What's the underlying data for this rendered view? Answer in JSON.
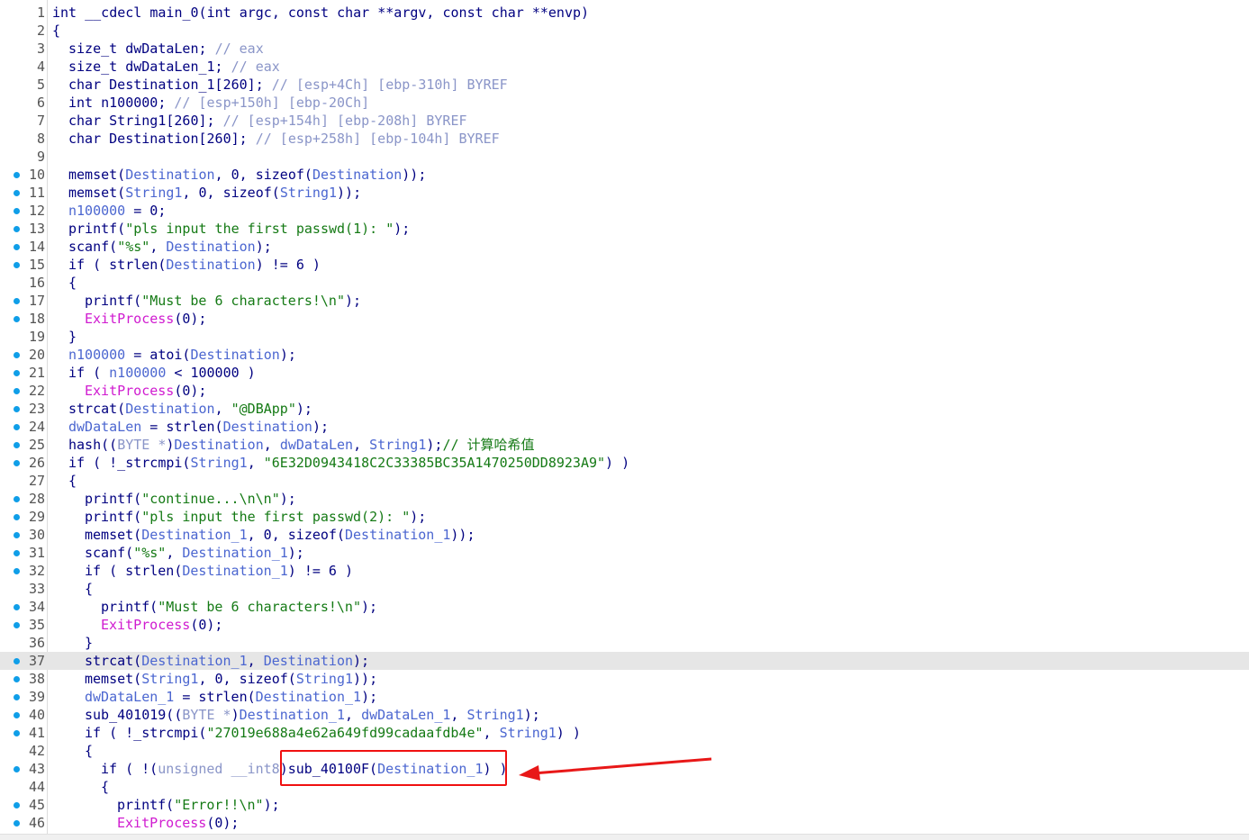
{
  "editor": {
    "lines": [
      {
        "n": "1",
        "bp": false,
        "indent": 0,
        "tokens": [
          [
            "int __cdecl main_0(int argc, const char **argv, const char **envp)",
            ""
          ]
        ]
      },
      {
        "n": "2",
        "bp": false,
        "indent": 0,
        "tokens": [
          [
            "{",
            ""
          ]
        ]
      },
      {
        "n": "3",
        "bp": false,
        "indent": 1,
        "tokens": [
          [
            "size_t dwDataLen; ",
            ""
          ],
          [
            "// eax",
            "c"
          ]
        ]
      },
      {
        "n": "4",
        "bp": false,
        "indent": 1,
        "tokens": [
          [
            "size_t dwDataLen_1; ",
            ""
          ],
          [
            "// eax",
            "c"
          ]
        ]
      },
      {
        "n": "5",
        "bp": false,
        "indent": 1,
        "tokens": [
          [
            "char Destination_1[260]; ",
            ""
          ],
          [
            "// [esp+4Ch] [ebp-310h] BYREF",
            "c"
          ]
        ]
      },
      {
        "n": "6",
        "bp": false,
        "indent": 1,
        "tokens": [
          [
            "int n100000; ",
            ""
          ],
          [
            "// [esp+150h] [ebp-20Ch]",
            "c"
          ]
        ]
      },
      {
        "n": "7",
        "bp": false,
        "indent": 1,
        "tokens": [
          [
            "char String1[260]; ",
            ""
          ],
          [
            "// [esp+154h] [ebp-208h] BYREF",
            "c"
          ]
        ]
      },
      {
        "n": "8",
        "bp": false,
        "indent": 1,
        "tokens": [
          [
            "char Destination[260]; ",
            ""
          ],
          [
            "// [esp+258h] [ebp-104h] BYREF",
            "c"
          ]
        ]
      },
      {
        "n": "9",
        "bp": false,
        "indent": 0,
        "tokens": []
      },
      {
        "n": "10",
        "bp": true,
        "indent": 1,
        "tokens": [
          [
            "memset(",
            ""
          ],
          [
            "Destination",
            "v"
          ],
          [
            ", 0, sizeof(",
            ""
          ],
          [
            "Destination",
            "v"
          ],
          [
            "));",
            ""
          ]
        ]
      },
      {
        "n": "11",
        "bp": true,
        "indent": 1,
        "tokens": [
          [
            "memset(",
            ""
          ],
          [
            "String1",
            "v"
          ],
          [
            ", 0, sizeof(",
            ""
          ],
          [
            "String1",
            "v"
          ],
          [
            "));",
            ""
          ]
        ]
      },
      {
        "n": "12",
        "bp": true,
        "indent": 1,
        "tokens": [
          [
            "n100000",
            "v"
          ],
          [
            " = 0;",
            ""
          ]
        ]
      },
      {
        "n": "13",
        "bp": true,
        "indent": 1,
        "tokens": [
          [
            "printf(",
            ""
          ],
          [
            "\"pls input the first passwd(1): \"",
            "s"
          ],
          [
            ");",
            ""
          ]
        ]
      },
      {
        "n": "14",
        "bp": true,
        "indent": 1,
        "tokens": [
          [
            "scanf(",
            ""
          ],
          [
            "\"%s\"",
            "s"
          ],
          [
            ", ",
            ""
          ],
          [
            "Destination",
            "v"
          ],
          [
            ");",
            ""
          ]
        ]
      },
      {
        "n": "15",
        "bp": true,
        "indent": 1,
        "tokens": [
          [
            "if ( strlen(",
            ""
          ],
          [
            "Destination",
            "v"
          ],
          [
            ") != 6 )",
            ""
          ]
        ]
      },
      {
        "n": "16",
        "bp": false,
        "indent": 1,
        "tokens": [
          [
            "{",
            ""
          ]
        ]
      },
      {
        "n": "17",
        "bp": true,
        "indent": 2,
        "tokens": [
          [
            "printf(",
            ""
          ],
          [
            "\"Must be 6 characters!\\n\"",
            "s"
          ],
          [
            ");",
            ""
          ]
        ]
      },
      {
        "n": "18",
        "bp": true,
        "indent": 2,
        "tokens": [
          [
            "ExitProcess",
            "m"
          ],
          [
            "(0);",
            ""
          ]
        ]
      },
      {
        "n": "19",
        "bp": false,
        "indent": 1,
        "tokens": [
          [
            "}",
            ""
          ]
        ]
      },
      {
        "n": "20",
        "bp": true,
        "indent": 1,
        "tokens": [
          [
            "n100000",
            "v"
          ],
          [
            " = atoi(",
            ""
          ],
          [
            "Destination",
            "v"
          ],
          [
            ");",
            ""
          ]
        ]
      },
      {
        "n": "21",
        "bp": true,
        "indent": 1,
        "tokens": [
          [
            "if ( ",
            ""
          ],
          [
            "n100000",
            "v"
          ],
          [
            " < 100000 )",
            ""
          ]
        ]
      },
      {
        "n": "22",
        "bp": true,
        "indent": 2,
        "tokens": [
          [
            "ExitProcess",
            "m"
          ],
          [
            "(0);",
            ""
          ]
        ]
      },
      {
        "n": "23",
        "bp": true,
        "indent": 1,
        "tokens": [
          [
            "strcat(",
            ""
          ],
          [
            "Destination",
            "v"
          ],
          [
            ", ",
            ""
          ],
          [
            "\"@DBApp\"",
            "s"
          ],
          [
            ");",
            ""
          ]
        ]
      },
      {
        "n": "24",
        "bp": true,
        "indent": 1,
        "tokens": [
          [
            "dwDataLen",
            "v"
          ],
          [
            " = strlen(",
            ""
          ],
          [
            "Destination",
            "v"
          ],
          [
            ");",
            ""
          ]
        ]
      },
      {
        "n": "25",
        "bp": true,
        "indent": 1,
        "tokens": [
          [
            "hash((",
            ""
          ],
          [
            "BYTE *",
            "c"
          ],
          [
            ")",
            ""
          ],
          [
            "Destination",
            "v"
          ],
          [
            ", ",
            ""
          ],
          [
            "dwDataLen",
            "v"
          ],
          [
            ", ",
            ""
          ],
          [
            "String1",
            "v"
          ],
          [
            ");",
            ""
          ],
          [
            "// 计算哈希值",
            "s"
          ]
        ]
      },
      {
        "n": "26",
        "bp": true,
        "indent": 1,
        "tokens": [
          [
            "if ( !_strcmpi(",
            ""
          ],
          [
            "String1",
            "v"
          ],
          [
            ", ",
            ""
          ],
          [
            "\"6E32D0943418C2C33385BC35A1470250DD8923A9\"",
            "s"
          ],
          [
            ") )",
            ""
          ]
        ]
      },
      {
        "n": "27",
        "bp": false,
        "indent": 1,
        "tokens": [
          [
            "{",
            ""
          ]
        ]
      },
      {
        "n": "28",
        "bp": true,
        "indent": 2,
        "tokens": [
          [
            "printf(",
            ""
          ],
          [
            "\"continue...\\n\\n\"",
            "s"
          ],
          [
            ");",
            ""
          ]
        ]
      },
      {
        "n": "29",
        "bp": true,
        "indent": 2,
        "tokens": [
          [
            "printf(",
            ""
          ],
          [
            "\"pls input the first passwd(2): \"",
            "s"
          ],
          [
            ");",
            ""
          ]
        ]
      },
      {
        "n": "30",
        "bp": true,
        "indent": 2,
        "tokens": [
          [
            "memset(",
            ""
          ],
          [
            "Destination_1",
            "v"
          ],
          [
            ", 0, sizeof(",
            ""
          ],
          [
            "Destination_1",
            "v"
          ],
          [
            "));",
            ""
          ]
        ]
      },
      {
        "n": "31",
        "bp": true,
        "indent": 2,
        "tokens": [
          [
            "scanf(",
            ""
          ],
          [
            "\"%s\"",
            "s"
          ],
          [
            ", ",
            ""
          ],
          [
            "Destination_1",
            "v"
          ],
          [
            ");",
            ""
          ]
        ]
      },
      {
        "n": "32",
        "bp": true,
        "indent": 2,
        "tokens": [
          [
            "if ( strlen(",
            ""
          ],
          [
            "Destination_1",
            "v"
          ],
          [
            ") != 6 )",
            ""
          ]
        ]
      },
      {
        "n": "33",
        "bp": false,
        "indent": 2,
        "tokens": [
          [
            "{",
            ""
          ]
        ]
      },
      {
        "n": "34",
        "bp": true,
        "indent": 3,
        "tokens": [
          [
            "printf(",
            ""
          ],
          [
            "\"Must be 6 characters!\\n\"",
            "s"
          ],
          [
            ");",
            ""
          ]
        ]
      },
      {
        "n": "35",
        "bp": true,
        "indent": 3,
        "tokens": [
          [
            "ExitProcess",
            "m"
          ],
          [
            "(0);",
            ""
          ]
        ]
      },
      {
        "n": "36",
        "bp": false,
        "indent": 2,
        "tokens": [
          [
            "}",
            ""
          ]
        ]
      },
      {
        "n": "37",
        "bp": true,
        "indent": 2,
        "hl": true,
        "tokens": [
          [
            "strcat(",
            ""
          ],
          [
            "Destination_1",
            "v"
          ],
          [
            ", ",
            ""
          ],
          [
            "Destination",
            "v"
          ],
          [
            ");",
            ""
          ]
        ]
      },
      {
        "n": "38",
        "bp": true,
        "indent": 2,
        "tokens": [
          [
            "memset(",
            ""
          ],
          [
            "String1",
            "v"
          ],
          [
            ", 0, sizeof(",
            ""
          ],
          [
            "String1",
            "v"
          ],
          [
            "));",
            ""
          ]
        ]
      },
      {
        "n": "39",
        "bp": true,
        "indent": 2,
        "tokens": [
          [
            "dwDataLen_1",
            "v"
          ],
          [
            " = strlen(",
            ""
          ],
          [
            "Destination_1",
            "v"
          ],
          [
            ");",
            ""
          ]
        ]
      },
      {
        "n": "40",
        "bp": true,
        "indent": 2,
        "tokens": [
          [
            "sub_401019((",
            ""
          ],
          [
            "BYTE *",
            "c"
          ],
          [
            ")",
            ""
          ],
          [
            "Destination_1",
            "v"
          ],
          [
            ", ",
            ""
          ],
          [
            "dwDataLen_1",
            "v"
          ],
          [
            ", ",
            ""
          ],
          [
            "String1",
            "v"
          ],
          [
            ");",
            ""
          ]
        ]
      },
      {
        "n": "41",
        "bp": true,
        "indent": 2,
        "tokens": [
          [
            "if ( !_strcmpi(",
            ""
          ],
          [
            "\"27019e688a4e62a649fd99cadaafdb4e\"",
            "s"
          ],
          [
            ", ",
            ""
          ],
          [
            "String1",
            "v"
          ],
          [
            ") )",
            ""
          ]
        ]
      },
      {
        "n": "42",
        "bp": false,
        "indent": 2,
        "tokens": [
          [
            "{",
            ""
          ]
        ]
      },
      {
        "n": "43",
        "bp": true,
        "indent": 3,
        "tokens": [
          [
            "if ( !(",
            ""
          ],
          [
            "unsigned __int8",
            "c"
          ],
          [
            ")sub_40100F(",
            ""
          ],
          [
            "Destination_1",
            "v"
          ],
          [
            ") )",
            ""
          ]
        ]
      },
      {
        "n": "44",
        "bp": false,
        "indent": 3,
        "tokens": [
          [
            "{",
            ""
          ]
        ]
      },
      {
        "n": "45",
        "bp": true,
        "indent": 4,
        "tokens": [
          [
            "printf(",
            ""
          ],
          [
            "\"Error!!\\n\"",
            "s"
          ],
          [
            ");",
            ""
          ]
        ]
      },
      {
        "n": "46",
        "bp": true,
        "indent": 4,
        "tokens": [
          [
            "ExitProcess",
            "m"
          ],
          [
            "(0);",
            ""
          ]
        ]
      }
    ]
  },
  "annotation": {
    "box_color": "#f01010",
    "arrow_color": "#e81818"
  }
}
